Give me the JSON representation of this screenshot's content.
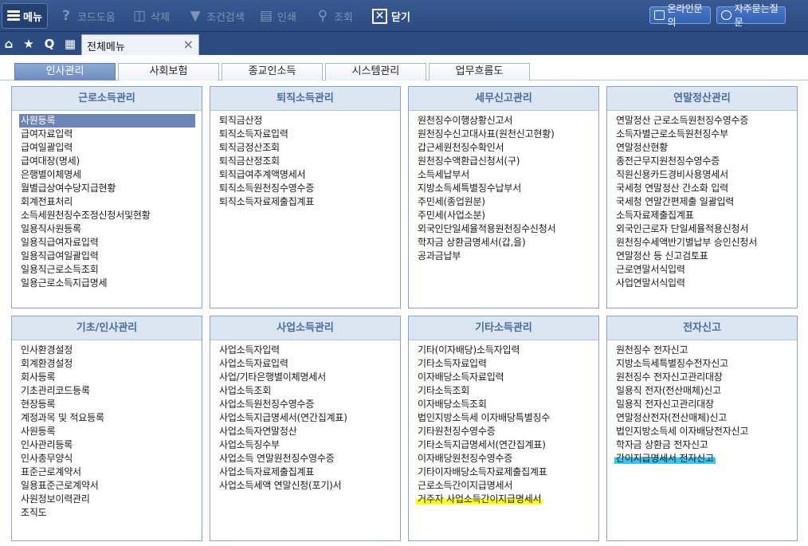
{
  "toolbar": {
    "menu": "메뉴",
    "buttons": [
      "코드도움",
      "삭제",
      "조건검색",
      "인쇄",
      "조회"
    ],
    "close": "닫기",
    "online_inquiry": "온라인문의",
    "faq": "자주묻는질문"
  },
  "tabstrip": {
    "quick_icons": [
      "home-icon",
      "star-icon",
      "search-q-icon",
      "calendar-icon"
    ],
    "quick_labels": [
      "Q"
    ],
    "open_tab": "전체메뉴",
    "close_symbol": "×"
  },
  "subtabs": [
    "인사관리",
    "사회보험",
    "종교인소득",
    "시스템관리",
    "업무흐름도"
  ],
  "panels": [
    {
      "title": "근로소득관리",
      "items": [
        "사원등록",
        "급여자료입력",
        "급여일괄입력",
        "급여대장(명세)",
        "은행별이체명세",
        "월별급상여수당지급현황",
        "회계전표처리",
        "소득세원천징수조정신청서및현황",
        "일용직사원등록",
        "일용직급여자료입력",
        "일용직급여일괄입력",
        "일용직근로소득조회",
        "일용근로소득지급명세"
      ]
    },
    {
      "title": "퇴직소득관리",
      "items": [
        "퇴직금산정",
        "퇴직소득자료입력",
        "퇴직금정산조회",
        "퇴직금산정조회",
        "퇴직급여추계액명세서",
        "퇴직소득원천징수영수증",
        "퇴직소득자료제출집계표"
      ]
    },
    {
      "title": "세무신고관리",
      "items": [
        "원천징수이행상황신고서",
        "원천징수신고대사표(원천신고현황)",
        "갑근세원천징수확인서",
        "원천징수액환급신청서(구)",
        "소득세납부서",
        "지방소득세특별징수납부서",
        "주민세(종업원분)",
        "주민세(사업소분)",
        "외국인단일세율적용원천징수신청서",
        "학자금 상환금명세서(갑,을)",
        "공과금납부"
      ]
    },
    {
      "title": "연말정산관리",
      "items": [
        "연말정산 근로소득원천징수영수증",
        "소득자별근로소득원천징수부",
        "연말정산현황",
        "종전근무지원천징수영수증",
        "직원신용카드경비사용명세서",
        "국세청 연말정산 간소화 입력",
        "국세청 연말간편제출 일괄입력",
        "소득자료제출집계표",
        "외국인근로자 단일세율적용신청서",
        "원천징수세액반기별납부 승인신청서",
        "연말정산 등 신고검토표",
        "근로연말서식입력",
        "사업연말서식입력"
      ]
    },
    {
      "title": "기초/인사관리",
      "items": [
        "인사환경설정",
        "회계환경설정",
        "회사등록",
        "기초관리코드등록",
        "현장등록",
        "계정과목 및 적요등록",
        "사원등록",
        "인사관리등록",
        "인사총무양식",
        "표준근로계약서",
        "일용표준근로계약서",
        "사원정보이력관리",
        "조직도"
      ]
    },
    {
      "title": "사업소득관리",
      "items": [
        "사업소득자입력",
        "사업소득자료입력",
        "사업/기타은행별이체명세서",
        "사업소득조회",
        "사업소득원천징수영수증",
        "사업소득지급명세서(연간집계표)",
        "사업소득자연말정산",
        "사업소득징수부",
        "사업소득 연말원천징수영수증",
        "사업소득자료제출집계표",
        "사업소득세액 연말신청(포기)서"
      ]
    },
    {
      "title": "기타소득관리",
      "items": [
        "기타(이자배당)소득자입력",
        "기타소득자료입력",
        "이자배당소득자료입력",
        "기타소득조회",
        "이자배당소득조회",
        "법인지방소득세 이자배당특별징수",
        "기타원천징수영수증",
        "기타소득지급명세서(연간집계표)",
        "이자배당원천징수영수증",
        "기타이자배당소득자료제출집계표",
        "근로소득간이지급명세서",
        "거주자 사업소득간이지급명세서"
      ]
    },
    {
      "title": "전자신고",
      "items": [
        "원천징수 전자신고",
        "지방소득세특별징수전자신고",
        "원천징수 전자신고관리대장",
        "일용직 전자(전산매체)신고",
        "일용직 전자신고관리대장",
        "연말정산전자(전산매체)신고",
        "법인지방소득세 이자배당전자신고",
        "학자금 상환금 전자신고",
        "간이지급명세서 전자신고"
      ]
    }
  ]
}
